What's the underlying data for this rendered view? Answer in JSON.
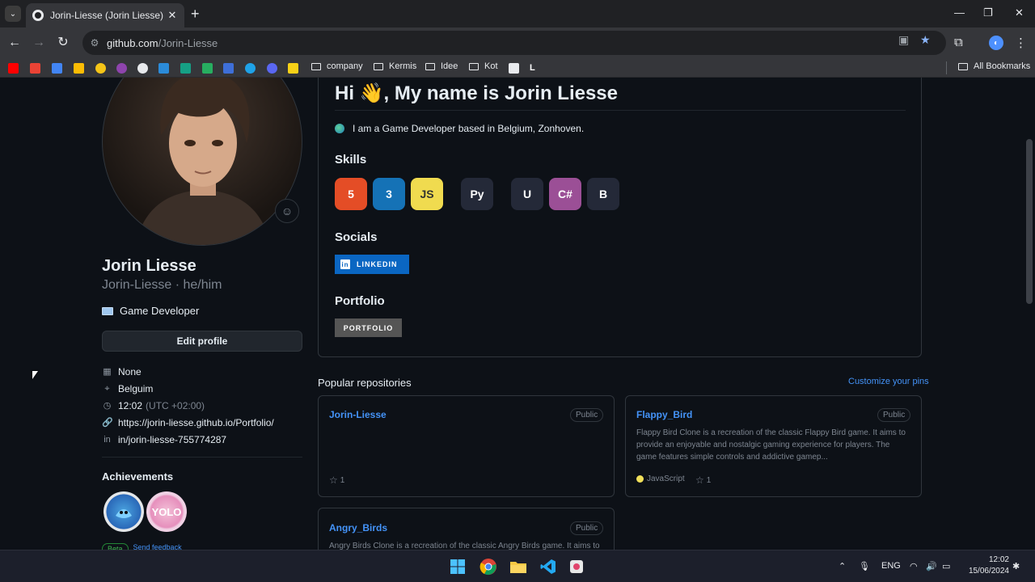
{
  "browser": {
    "tab_title": "Jorin-Liesse (Jorin Liesse)",
    "url_host": "github.com",
    "url_path": "/Jorin-Liesse",
    "new_tab": "+",
    "tab_close": "✕",
    "window_controls": {
      "minimize": "—",
      "restore": "❐",
      "close": "✕"
    },
    "bookmark_folders": [
      "company",
      "Kermis",
      "Idee",
      "Kot"
    ],
    "all_bookmarks": "All Bookmarks",
    "colors": {
      "frame": "#202124",
      "toolbar": "#35363a",
      "accent": "#4d90fe"
    }
  },
  "profile": {
    "name": "Jorin Liesse",
    "username_line": "Jorin-Liesse · he/him",
    "bio": "Game Developer",
    "edit_button": "Edit profile",
    "company": "None",
    "location": "Belguim",
    "time": "12:02",
    "timezone": "(UTC +02:00)",
    "website": "https://jorin-liesse.github.io/Portfolio/",
    "linkedin": "in/jorin-liesse-755774287",
    "achievements_title": "Achievements",
    "badge_text": "YOLO",
    "beta": "Beta",
    "feedback": "Send feedback"
  },
  "readme": {
    "greeting": "Hi 👋, My name is Jorin Liesse",
    "intro": "I am a Game Developer based in Belgium, Zonhoven.",
    "skills_heading": "Skills",
    "skills": [
      {
        "name": "html5-icon",
        "label": "5",
        "bg": "#e44d26"
      },
      {
        "name": "css3-icon",
        "label": "3",
        "bg": "#1572b6"
      },
      {
        "name": "javascript-icon",
        "label": "JS",
        "bg": "#f0db4f"
      },
      {
        "name": "python-icon",
        "label": "Py",
        "bg": "#242938"
      },
      {
        "name": "unity-icon",
        "label": "U",
        "bg": "#242938"
      },
      {
        "name": "csharp-icon",
        "label": "C#",
        "bg": "#9b4f96"
      },
      {
        "name": "blender-icon",
        "label": "B",
        "bg": "#242938"
      }
    ],
    "socials_heading": "Socials",
    "linkedin_button": "LINKEDIN",
    "portfolio_heading": "Portfolio",
    "portfolio_button": "PORTFOLIO"
  },
  "repos": {
    "title": "Popular repositories",
    "customize": "Customize your pins",
    "items": [
      {
        "name": "Jorin-Liesse",
        "visibility": "Public",
        "description": "",
        "language": "",
        "stars": "1"
      },
      {
        "name": "Flappy_Bird",
        "visibility": "Public",
        "description": "Flappy Bird Clone is a recreation of the classic Flappy Bird game. It aims to provide an enjoyable and nostalgic gaming experience for players. The game features simple controls and addictive gamep...",
        "language": "JavaScript",
        "stars": "1"
      },
      {
        "name": "Angry_Birds",
        "visibility": "Public",
        "description": "Angry Birds Clone is a recreation of the classic Angry Birds game. It aims to",
        "language": "",
        "stars": ""
      }
    ]
  },
  "taskbar": {
    "language": "ENG",
    "time": "12:02",
    "date": "15/06/2024"
  }
}
